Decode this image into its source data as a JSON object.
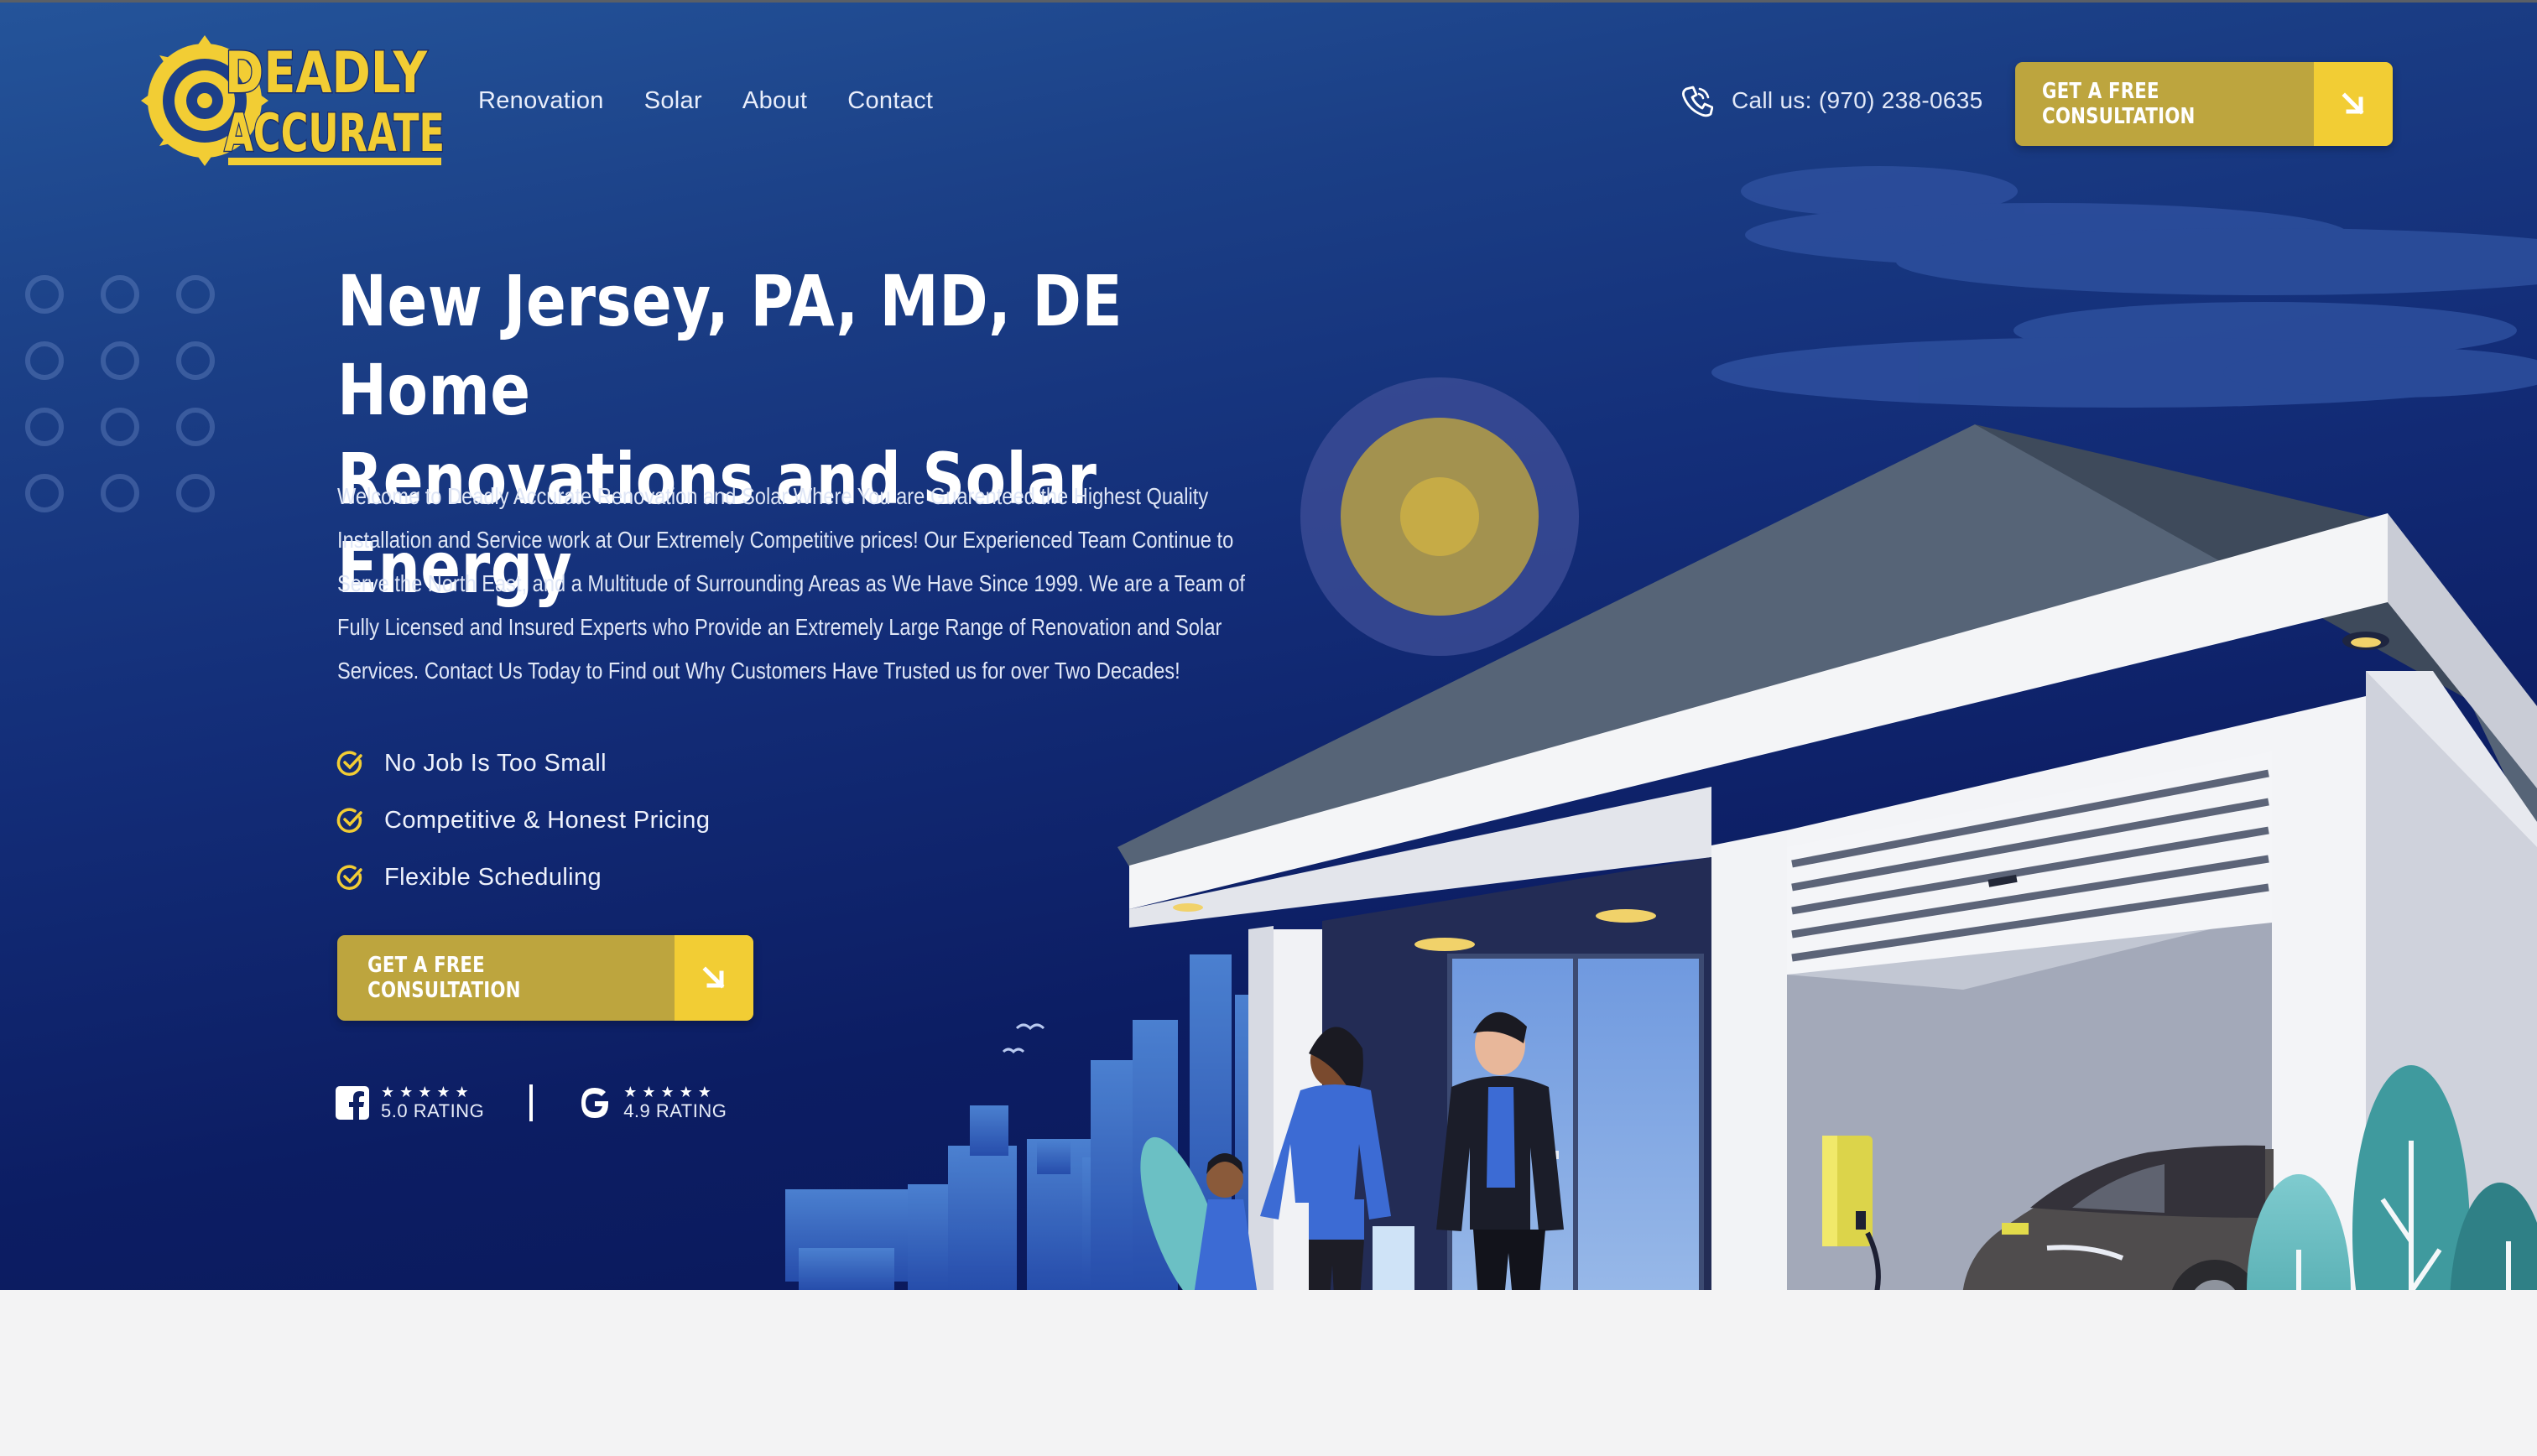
{
  "logo": {
    "line1": "DEADLY",
    "line2": "ACCURATE"
  },
  "nav": {
    "items": [
      "Renovation",
      "Solar",
      "About",
      "Contact"
    ]
  },
  "header": {
    "call_text": "Call us: (970) 238-0635",
    "cta_label": "GET A FREE CONSULTATION"
  },
  "hero": {
    "title_line1": "New Jersey, PA, MD, DE Home",
    "title_line2": "Renovations and Solar Energy",
    "intro": "Welcome to Deadly Accurate Renovation and Solar Where You are Guarenteed the Highest Quality Installation and Service work at Our Extremely Competitive prices! Our Experienced Team Continue to Serve the North East, and a Multitude of Surrounding Areas as We Have Since 1999. We are a Team of Fully Licensed and Insured Experts who Provide an Extremely Large Range of Renovation and Solar Services. Contact Us Today to Find out Why Customers Have Trusted us for over Two Decades!",
    "features": [
      "No Job Is Too Small",
      "Competitive & Honest Pricing",
      "Flexible Scheduling"
    ],
    "cta_label": "GET A FREE CONSULTATION"
  },
  "ratings": {
    "facebook": {
      "stars": "★★★★★",
      "label": "5.0 RATING",
      "value": 5.0
    },
    "google": {
      "stars": "★★★★★",
      "label": "4.9 RATING",
      "value": 4.9
    }
  },
  "colors": {
    "brand_yellow": "#f2cd34",
    "button_gold": "#bda53e",
    "hero_blue": "#132d78",
    "check_yellow": "#f2cd34"
  },
  "icons": [
    "saw-blade-logo-icon",
    "phone-icon",
    "arrow-down-right-icon",
    "check-circle-icon",
    "facebook-icon",
    "google-icon"
  ]
}
